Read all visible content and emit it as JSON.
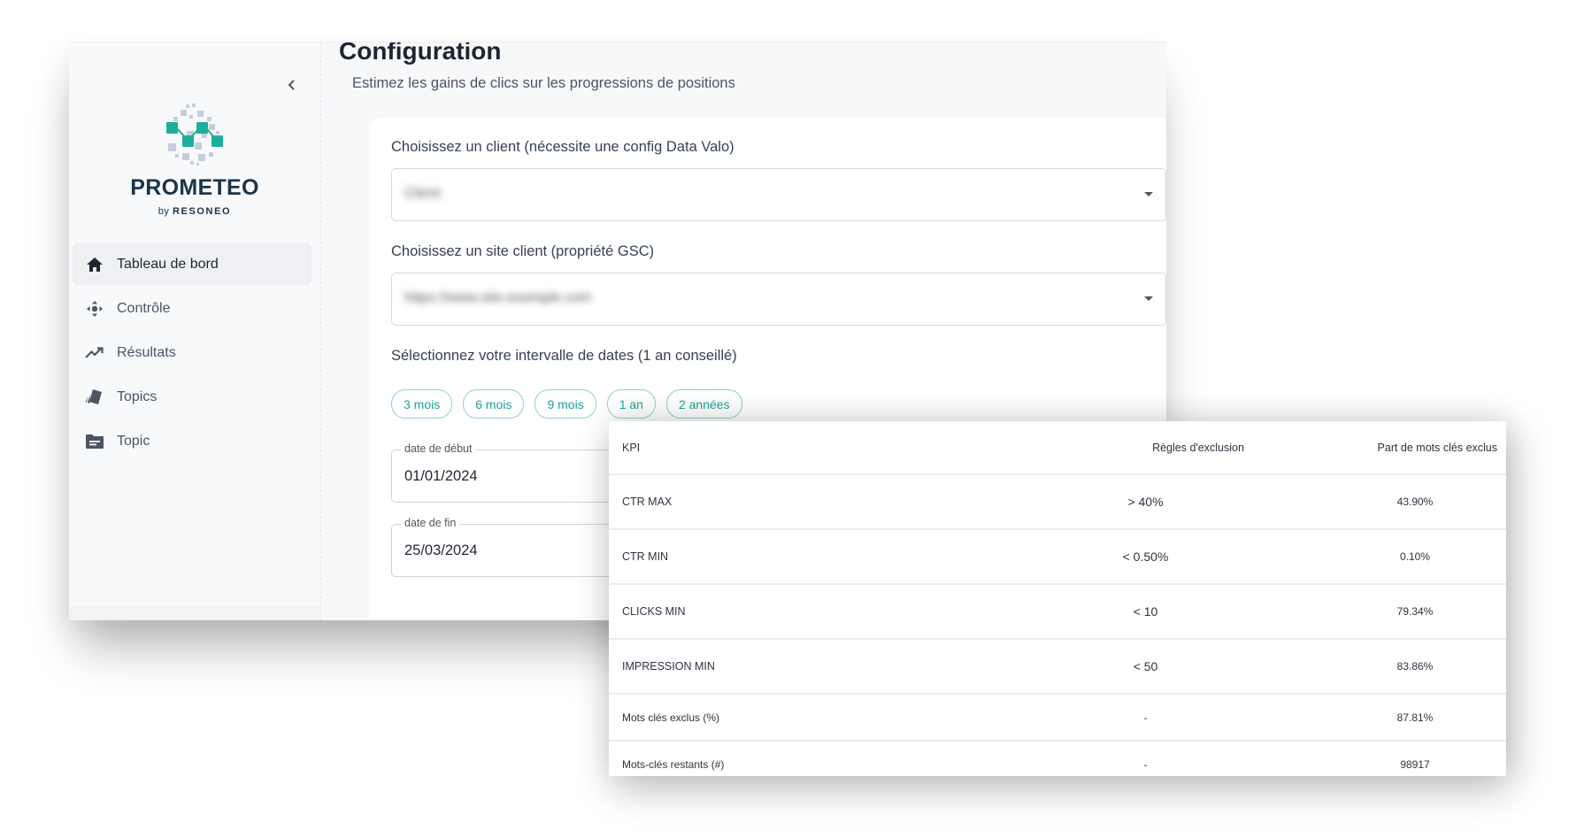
{
  "sidebar": {
    "collapse_icon": "chevron-left-icon",
    "brand": "PROMETEO",
    "by_prefix": "by",
    "company": "RESONEO",
    "items": [
      {
        "label": "Tableau de bord",
        "icon": "home-icon",
        "active": true
      },
      {
        "label": "Contrôle",
        "icon": "move-arrows-icon",
        "active": false
      },
      {
        "label": "Résultats",
        "icon": "trending-up-icon",
        "active": false
      },
      {
        "label": "Topics",
        "icon": "cards-icon",
        "active": false
      },
      {
        "label": "Topic",
        "icon": "folder-icon",
        "active": false
      }
    ]
  },
  "main": {
    "title": "Configuration",
    "subtitle": "Estimez les gains de clics sur les progressions de positions",
    "client_select": {
      "label": "Choisissez un client (nécessite une config Data Valo)",
      "value": "Client"
    },
    "site_select": {
      "label": "Choisissez un site client (propriété GSC)",
      "value": "https://www.site-exemple.com"
    },
    "date_range": {
      "label": "Sélectionnez votre intervalle de dates (1 an conseillé)",
      "presets": [
        "3 mois",
        "6 mois",
        "9 mois",
        "1 an",
        "2 années"
      ],
      "start": {
        "legend": "date de début",
        "value": "01/01/2024"
      },
      "end": {
        "legend": "date de fin",
        "value": "25/03/2024"
      }
    }
  },
  "kpi_table": {
    "headers": [
      "KPI",
      "Règles d'exclusion",
      "Part de mots clés exclus"
    ],
    "rows": [
      [
        "CTR MAX",
        "> 40%",
        "43.90%"
      ],
      [
        "CTR MIN",
        "< 0.50%",
        "0.10%"
      ],
      [
        "CLICKS MIN",
        "< 10",
        "79.34%"
      ],
      [
        "IMPRESSION MIN",
        "< 50",
        "83.86%"
      ],
      [
        "Mots clés exclus (%)",
        "-",
        "87.81%"
      ],
      [
        "Mots-clés restants (#)",
        "-",
        "98917"
      ]
    ]
  },
  "colors": {
    "brand_teal": "#1fae9c",
    "brand_navy": "#1b3449",
    "chip_border": "#8ad3c8",
    "chip_text": "#1ba69a"
  }
}
